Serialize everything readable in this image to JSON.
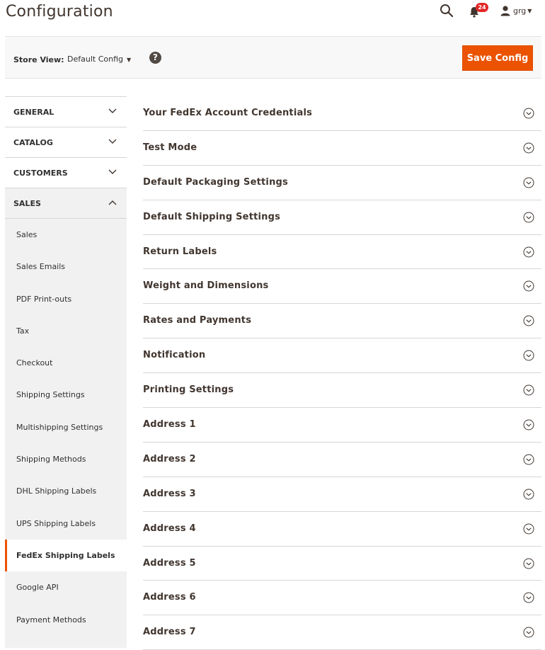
{
  "header": {
    "title": "Configuration",
    "notification_count": "24",
    "user_name": "grg"
  },
  "store_bar": {
    "label": "Store View:",
    "selected": "Default Config",
    "save_label": "Save Config"
  },
  "colors": {
    "accent": "#eb5202",
    "badge": "#e22626"
  },
  "sidebar": {
    "tabs": [
      {
        "label": "GENERAL",
        "state": "collapsed"
      },
      {
        "label": "CATALOG",
        "state": "collapsed"
      },
      {
        "label": "CUSTOMERS",
        "state": "collapsed"
      },
      {
        "label": "SALES",
        "state": "expanded"
      }
    ],
    "sales_items": [
      "Sales",
      "Sales Emails",
      "PDF Print-outs",
      "Tax",
      "Checkout",
      "Shipping Settings",
      "Multishipping Settings",
      "Shipping Methods",
      "DHL Shipping Labels",
      "UPS Shipping Labels",
      "FedEx Shipping Labels",
      "Google API",
      "Payment Methods"
    ],
    "active_item": "FedEx Shipping Labels"
  },
  "sections": [
    "Your FedEx Account Credentials",
    "Test Mode",
    "Default Packaging Settings",
    "Default Shipping Settings",
    "Return Labels",
    "Weight and Dimensions",
    "Rates and Payments",
    "Notification",
    "Printing Settings",
    "Address 1",
    "Address 2",
    "Address 3",
    "Address 4",
    "Address 5",
    "Address 6",
    "Address 7"
  ]
}
